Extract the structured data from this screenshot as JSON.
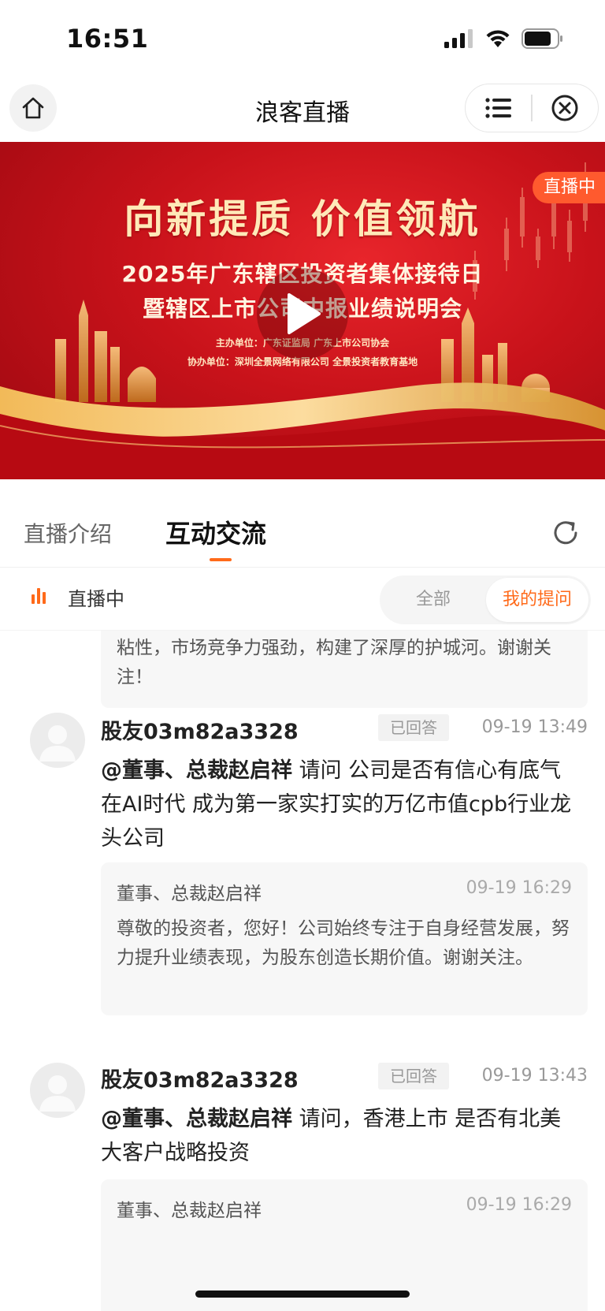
{
  "status_bar": {
    "time": "16:51"
  },
  "nav": {
    "title": "浪客直播"
  },
  "banner": {
    "slogan": "向新提质  价值领航",
    "title_line1": "2025年广东辖区投资者集体接待日",
    "title_line2": "暨辖区上市公司中报业绩说明会",
    "host_line": "主办单位：广东证监局  广东上市公司协会",
    "co_host_line": "协办单位：深圳全景网络有限公司  全景投资者教育基地",
    "live_badge": "直播中"
  },
  "tabs": {
    "intro": "直播介绍",
    "chat": "互动交流"
  },
  "filter": {
    "live_status": "直播中",
    "all": "全部",
    "mine": "我的提问"
  },
  "feed": {
    "partial_reply": {
      "text": "粘性，市场竞争力强劲，构建了深厚的护城河。谢谢关注！"
    },
    "items": [
      {
        "user": "股友03m82a3328",
        "status": "已回答",
        "time": "09-19 13:49",
        "mention": "@董事、总裁赵启祥",
        "question": " 请问 公司是否有信心有底气 在AI时代 成为第一家实打实的万亿市值cpb行业龙头公司",
        "reply": {
          "name": "董事、总裁赵启祥",
          "time": "09-19 16:29",
          "text": "尊敬的投资者，您好！公司始终专注于自身经营发展，努力提升业绩表现，为股东创造长期价值。谢谢关注。"
        }
      },
      {
        "user": "股友03m82a3328",
        "status": "已回答",
        "time": "09-19 13:43",
        "mention": "@董事、总裁赵启祥",
        "question": " 请问，香港上市 是否有北美大客户战略投资",
        "reply": {
          "name": "董事、总裁赵启祥",
          "time": "09-19 16:29",
          "text": ""
        }
      }
    ]
  },
  "colors": {
    "accent": "#ff6a1a",
    "live_badge": "#ff5a2e",
    "banner_red": "#c8121a"
  }
}
